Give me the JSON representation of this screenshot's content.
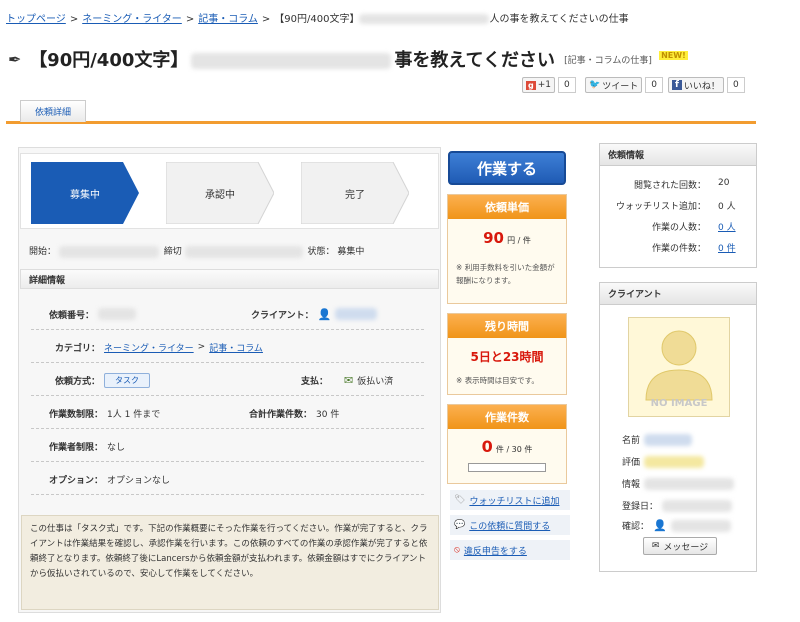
{
  "breadcrumb": {
    "items": [
      "トップページ",
      "ネーミング・ライター",
      "記事・コラム"
    ],
    "current": "【90円/400文字】",
    "current_tail": "人の事を教えてくださいの仕事",
    "separator": ">"
  },
  "title": {
    "text_head": "【90円/400文字】",
    "text_tail": "事を教えてください",
    "tag": "[記事・コラムの仕事]",
    "new_badge": "NEW!"
  },
  "social": {
    "google": {
      "label": "+1",
      "count": "0"
    },
    "twitter": {
      "label": "ツイート",
      "count": "0"
    },
    "facebook": {
      "label": "いいね！",
      "count": "0"
    }
  },
  "tabs": [
    {
      "label": "依頼詳細",
      "active": true
    }
  ],
  "steps": [
    {
      "label": "募集中",
      "active": true
    },
    {
      "label": "承認中",
      "active": false
    },
    {
      "label": "完了",
      "active": false
    }
  ],
  "meta": {
    "start_label": "開始：",
    "deadline_label": "締切",
    "status_label": "状態：",
    "status_value": "募集中"
  },
  "details": {
    "section_title": "詳細情報",
    "request_no_label": "依頼番号：",
    "client_label": "クライアント：",
    "category_label": "カテゴリ：",
    "category_link1": "ネーミング・ライター",
    "category_sep": ">",
    "category_link2": "記事・コラム",
    "method_label": "依頼方式：",
    "method_value": "タスク",
    "payment_label": "支払：",
    "payment_value": "仮払い済",
    "limit_label": "作業数制限：",
    "limit_value": "1人 1 件まで",
    "total_label": "合計作業件数：",
    "total_value": "30 件",
    "worker_limit_label": "作業者制限：",
    "worker_limit_value": "なし",
    "option_label": "オプション：",
    "option_value": "オプションなし"
  },
  "notice": {
    "text": "この仕事は「タスク式」です。下記の作業概要にそった作業を行ってください。作業が完了すると、クライアントは作業結果を確認し、承認作業を行います。この依頼のすべての作業の承認作業が完了すると依頼終了となります。依頼終了後にLancersから依頼金額が支払われます。依頼金額はすでにクライアントから仮払いされているので、安心して作業をしてください。"
  },
  "work_button": "作業する",
  "unit_price": {
    "header": "依頼単価",
    "value": "90",
    "unit": "円 / 件",
    "note_mark": "※",
    "note": "利用手数料を引いた金額が報酬になります。"
  },
  "remaining": {
    "header": "残り時間",
    "value": "5日と23時間",
    "note_mark": "※",
    "note": "表示時間は目安です。"
  },
  "work_count": {
    "header": "作業件数",
    "value": "0",
    "unit": "件 / 30 件",
    "progress": 0
  },
  "links": {
    "watchlist": "ウォッチリストに追加",
    "question": "この依頼に質問する",
    "report": "違反申告をする"
  },
  "request_info": {
    "header": "依頼情報",
    "rows": [
      {
        "label": "閲覧された回数：",
        "value": "20",
        "link": false
      },
      {
        "label": "ウォッチリスト追加：",
        "value": "0 人",
        "link": false
      },
      {
        "label": "作業の人数：",
        "value": "0 人",
        "link": true
      },
      {
        "label": "作業の件数：",
        "value": "0 件",
        "link": true
      }
    ]
  },
  "client_box": {
    "header": "クライアント",
    "no_image": "NO IMAGE",
    "name_label": "名前",
    "rating_label": "評価",
    "info_label": "情報",
    "registered_label": "登録日：",
    "verified_label": "確認：",
    "message_button": "メッセージ"
  },
  "colors": {
    "accent_blue": "#1a5cb5",
    "orange": "#f29c30",
    "price_red": "#d8180c"
  }
}
